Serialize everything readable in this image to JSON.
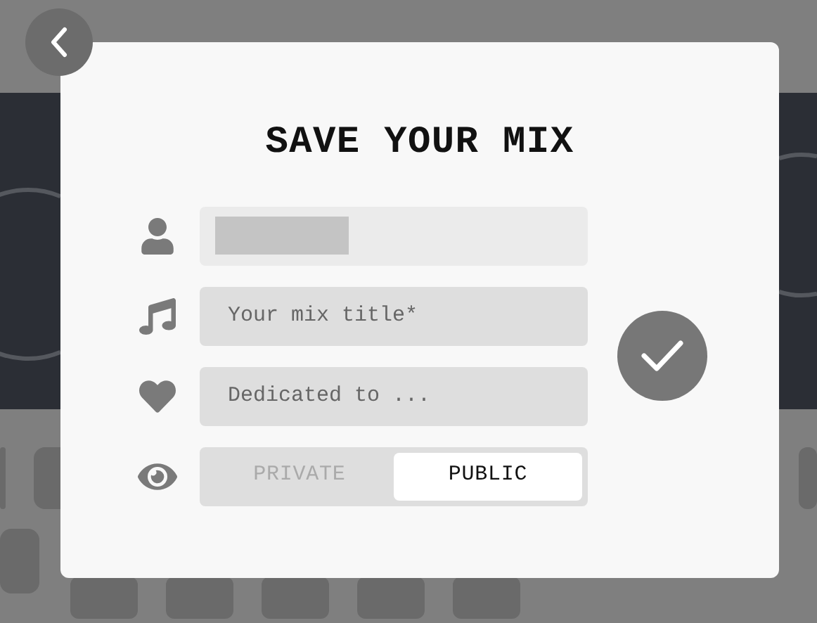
{
  "dialog": {
    "title": "SAVE YOUR MIX",
    "fields": [
      {
        "kind": "user",
        "redacted": true
      },
      {
        "kind": "music",
        "placeholder": "Your mix title*"
      },
      {
        "kind": "heart",
        "placeholder": "Dedicated to ..."
      }
    ],
    "visibility": {
      "kind": "eye",
      "options": [
        {
          "label": "PRIVATE",
          "selected": false
        },
        {
          "label": "PUBLIC",
          "selected": true
        }
      ]
    }
  }
}
